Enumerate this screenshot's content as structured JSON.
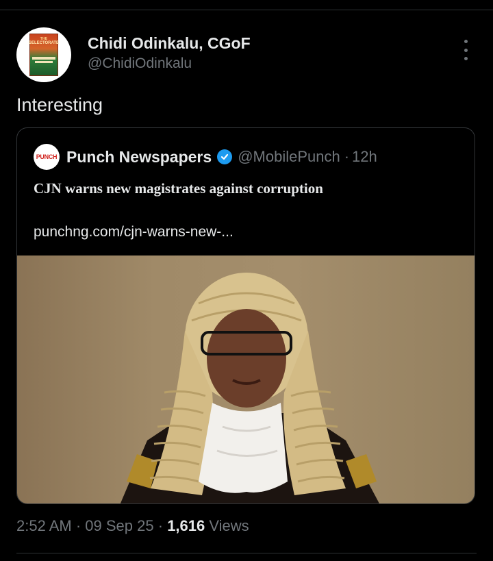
{
  "author": {
    "name": "Chidi Odinkalu, CGoF",
    "handle": "@ChidiOdinkalu",
    "avatar_icon": "book-cover-avatar",
    "avatar_book_title_line1": "THE",
    "avatar_book_title_line2": "SELECTORATE"
  },
  "tweet": {
    "text": "Interesting"
  },
  "quoted_post": {
    "logo_text": "PUNCH",
    "name": "Punch Newspapers",
    "verified": true,
    "handle": "@MobilePunch",
    "separator": "·",
    "time": "12h",
    "headline": "CJN warns new magistrates against corruption",
    "link": "punchng.com/cjn-warns-new-...",
    "image_icon": "portrait-photo"
  },
  "meta": {
    "time": "2:52 AM",
    "sep1": "·",
    "date": "09 Sep 25",
    "sep2": "·",
    "views_count": "1,616",
    "views_label": "Views"
  },
  "colors": {
    "background": "#000000",
    "text": "#e7e9ea",
    "secondary": "#71767b",
    "verified": "#1d9bf0",
    "punch_red": "#d1231f"
  }
}
